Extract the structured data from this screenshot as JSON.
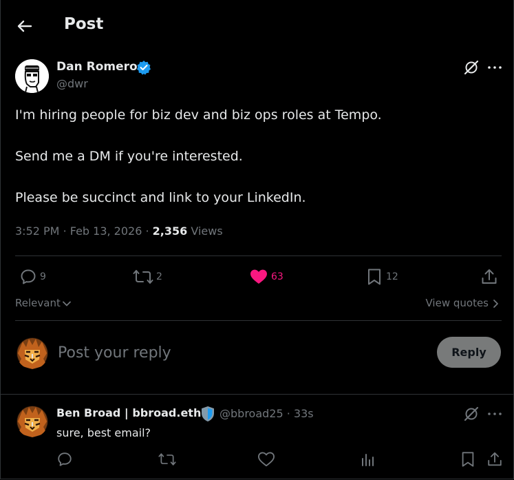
{
  "header": {
    "title": "Post"
  },
  "post": {
    "author_name": "Dan Romero",
    "author_handle": "@dwr",
    "lines": [
      "I'm hiring people for biz dev and biz ops roles at Tempo.",
      "Send me a DM if you're interested.",
      "Please be succinct and link to your LinkedIn."
    ],
    "time": "3:52 PM",
    "date": "Feb 13, 2026",
    "views_count": "2,356",
    "views_label": "Views",
    "stats": {
      "replies": "9",
      "reposts": "2",
      "likes": "63",
      "bookmarks": "12"
    }
  },
  "sort": {
    "label": "Relevant",
    "view_quotes": "View quotes"
  },
  "composer": {
    "placeholder": "Post your reply",
    "reply_label": "Reply"
  },
  "reply": {
    "author_name": "Ben Broad | bbroad.eth",
    "author_handle": "@bbroad25",
    "time": "33s",
    "text": "sure, best email?"
  },
  "colors": {
    "background": "#000000",
    "text": "#e7e9ea",
    "muted": "#71767b",
    "like_pink": "#f91880",
    "verified_blue": "#1d9bf0",
    "divider": "#2f3336",
    "reply_button": "#787a7a"
  },
  "icons": {
    "back": "arrow-left-icon",
    "verified": "verified-badge-icon",
    "grok": "grok-icon",
    "more": "more-horizontal-icon",
    "reply": "reply-bubble-icon",
    "repost": "repost-icon",
    "like": "heart-icon",
    "bookmark": "bookmark-icon",
    "share": "share-icon",
    "analytics": "analytics-bars-icon",
    "shield": "shield-badge-icon"
  }
}
